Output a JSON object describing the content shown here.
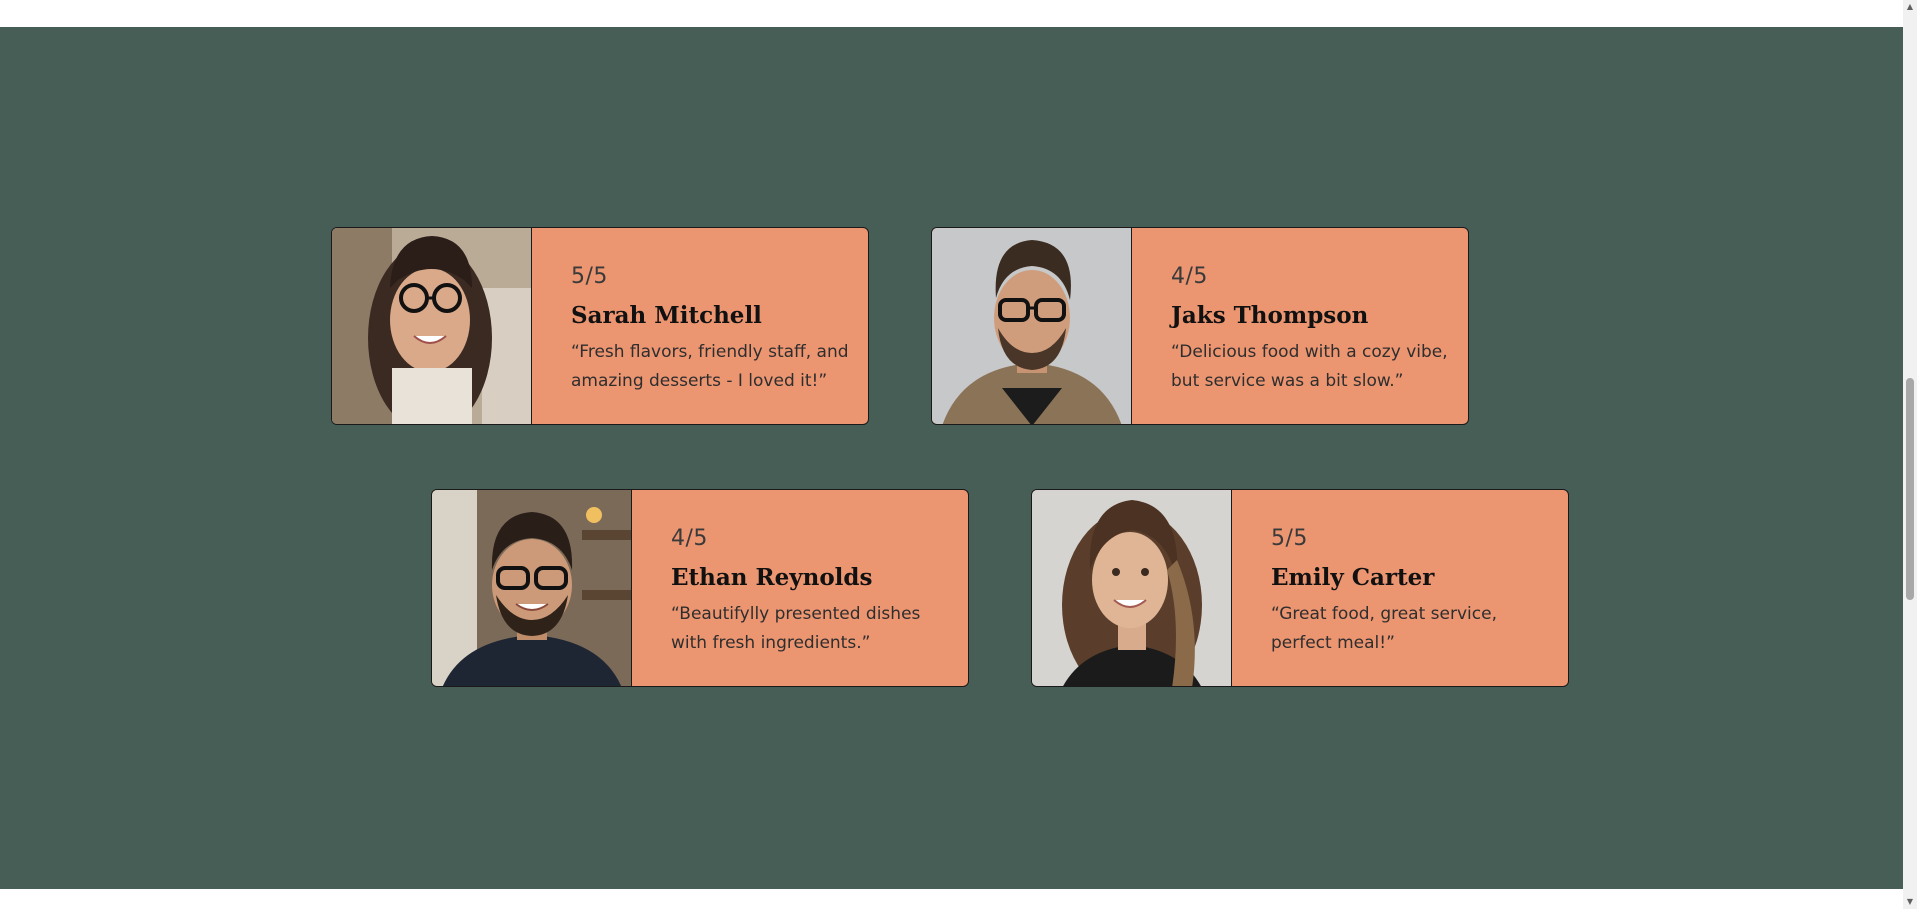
{
  "testimonials": [
    {
      "rating": "5/5",
      "name": "Sarah Mitchell",
      "quote": "“Fresh flavors, friendly staff, and amazing desserts - I loved it!”",
      "photo_icon": "woman-with-glasses-portrait"
    },
    {
      "rating": "4/5",
      "name": "Jaks Thompson",
      "quote": "“Delicious food with a cozy vibe, but service was a bit slow.”",
      "photo_icon": "man-with-glasses-portrait"
    },
    {
      "rating": "4/5",
      "name": "Ethan Reynolds",
      "quote": "“Beautifylly presented dishes with fresh ingredients.”",
      "photo_icon": "smiling-man-portrait"
    },
    {
      "rating": "5/5",
      "name": "Emily Carter",
      "quote": "“Great food, great service, perfect meal!”",
      "photo_icon": "smiling-woman-portrait"
    }
  ],
  "scrollbar": {
    "up_icon": "▲",
    "down_icon": "▼"
  },
  "colors": {
    "section_bg": "#475e57",
    "card_bg": "#ec9571",
    "card_border": "#1a1a1a"
  }
}
